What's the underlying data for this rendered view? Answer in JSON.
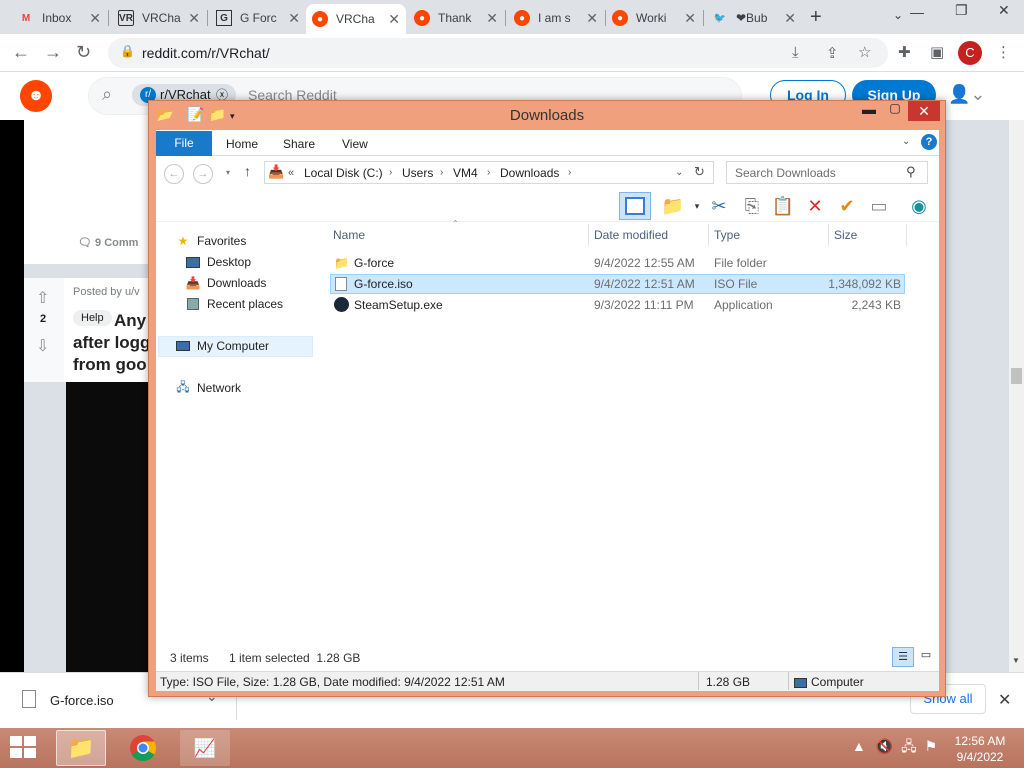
{
  "browser": {
    "tabs": [
      {
        "label": "Inbox",
        "favicon": "gmail"
      },
      {
        "label": "VRCha",
        "favicon": "vrchat"
      },
      {
        "label": "G Forc",
        "favicon": "g-force"
      },
      {
        "label": "VRCha",
        "favicon": "reddit",
        "active": true
      },
      {
        "label": "Thank",
        "favicon": "reddit"
      },
      {
        "label": "I am s",
        "favicon": "reddit"
      },
      {
        "label": "Worki",
        "favicon": "reddit"
      },
      {
        "label": "❤Bub",
        "favicon": "twitter"
      }
    ],
    "new_tab": "+",
    "url": "reddit.com/r/VRchat/",
    "profile_initial": "C"
  },
  "reddit": {
    "subreddit_chip": "r/VRchat",
    "search_placeholder": "Search Reddit",
    "login": "Log In",
    "signup": "Sign Up",
    "comments_partial": "9 Comm",
    "posted_by_partial": "Posted by u/v",
    "vote_count": "2",
    "flair": "Help",
    "title_partial_1": "Any",
    "title_partial_2": "after logg",
    "title_partial_3": "from goo"
  },
  "explorer": {
    "title": "Downloads",
    "ribbon_tabs": {
      "file": "File",
      "home": "Home",
      "share": "Share",
      "view": "View"
    },
    "breadcrumb": [
      "Local Disk (C:)",
      "Users",
      "VM4",
      "Downloads"
    ],
    "search_placeholder": "Search Downloads",
    "nav": {
      "favorites": "Favorites",
      "desktop": "Desktop",
      "downloads": "Downloads",
      "recent": "Recent places",
      "computer": "My Computer",
      "network": "Network"
    },
    "columns": {
      "name": "Name",
      "date": "Date modified",
      "type": "Type",
      "size": "Size"
    },
    "files": [
      {
        "name": "G-force",
        "date": "9/4/2022 12:55 AM",
        "type": "File folder",
        "size": "",
        "icon": "folder-icon"
      },
      {
        "name": "G-force.iso",
        "date": "9/4/2022 12:51 AM",
        "type": "ISO File",
        "size": "1,348,092 KB",
        "icon": "iso-file-icon",
        "selected": true
      },
      {
        "name": "SteamSetup.exe",
        "date": "9/3/2022 11:11 PM",
        "type": "Application",
        "size": "2,243 KB",
        "icon": "steam-icon"
      }
    ],
    "status": {
      "count": "3 items",
      "selected": "1 item selected  1.28 GB"
    },
    "infobar": {
      "details": "Type: ISO File, Size: 1.28 GB, Date modified: 9/4/2022 12:51 AM",
      "size": "1.28 GB",
      "location": "Computer"
    }
  },
  "downloads_bar": {
    "file": "G-force.iso",
    "show_all": "Show all"
  },
  "taskbar": {
    "time": "12:56 AM",
    "date": "9/4/2022"
  },
  "colors": {
    "reddit": "#ff4500",
    "reddit_blue": "#0079d3",
    "explorer_frame": "#f0a07d",
    "selection": "#cce8ff",
    "taskbar": "#c17d67"
  }
}
